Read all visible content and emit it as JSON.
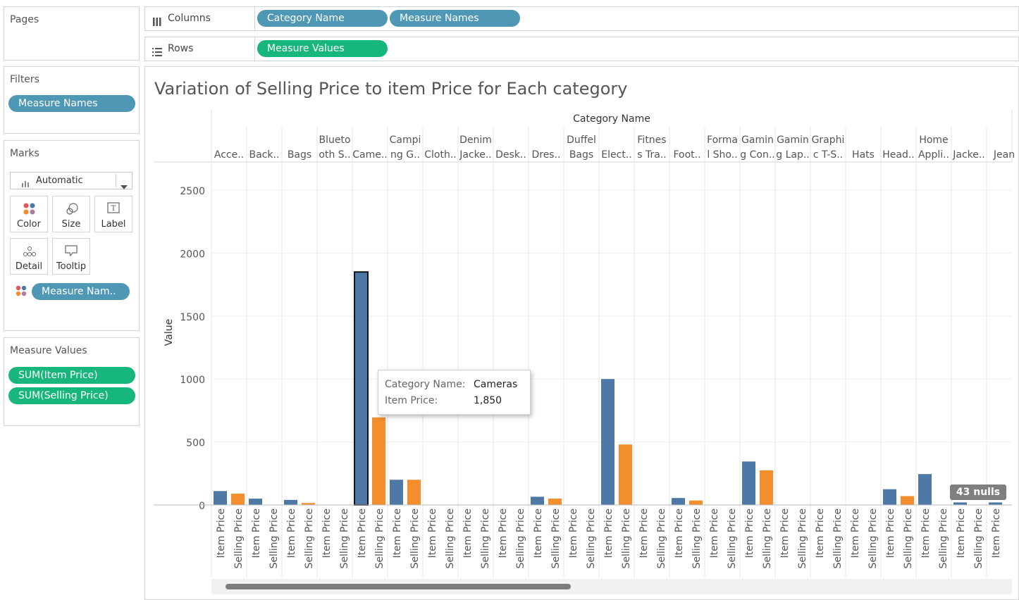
{
  "pages": {
    "title": "Pages"
  },
  "filters": {
    "title": "Filters",
    "pills": [
      "Measure Names"
    ]
  },
  "marks": {
    "title": "Marks",
    "mark_type": "Automatic",
    "buttons": [
      "Color",
      "Size",
      "Label",
      "Detail",
      "Tooltip"
    ],
    "color_pill": "Measure Nam.."
  },
  "measure_values": {
    "title": "Measure Values",
    "pills": [
      "SUM(Item Price)",
      "SUM(Selling Price)"
    ]
  },
  "shelves": {
    "columns_label": "Columns",
    "columns_pills": [
      "Category Name",
      "Measure Names"
    ],
    "rows_label": "Rows",
    "rows_pills": [
      "Measure Values"
    ]
  },
  "colors": {
    "pill_blue": "#4e97b5",
    "pill_green": "#17b67a",
    "series_item": "#4e79a7",
    "series_selling": "#f28e2b"
  },
  "tooltip": {
    "k1": "Category Name:",
    "v1": "Cameras",
    "k2": "Item Price:",
    "v2": "1,850"
  },
  "nulls_badge": "43 nulls",
  "chart_data": {
    "type": "bar",
    "title": "Variation of Selling Price to item Price for Each category",
    "column_header": "Category Name",
    "ylabel": "Value",
    "ylim": [
      0,
      2500
    ],
    "yticks": [
      0,
      500,
      1000,
      1500,
      2000,
      2500
    ],
    "grid": true,
    "measure_labels": [
      "Item Price",
      "Selling Price"
    ],
    "categories": [
      [
        "Acce.."
      ],
      [
        "Back.."
      ],
      [
        "Bags"
      ],
      [
        "Blueto",
        "oth S.."
      ],
      [
        "Came.."
      ],
      [
        "Campi",
        "ng G.."
      ],
      [
        "Cloth.."
      ],
      [
        "Denim",
        "Jacke.."
      ],
      [
        "Desk.."
      ],
      [
        "Dres.."
      ],
      [
        "Duffel",
        "Bags"
      ],
      [
        "Elect.."
      ],
      [
        "Fitnes",
        "s Tra.."
      ],
      [
        "Foot.."
      ],
      [
        "Forma",
        "l Sho.."
      ],
      [
        "Gamin",
        "g Con.."
      ],
      [
        "Gamin",
        "g Lap.."
      ],
      [
        "Graphi",
        "c T-S.."
      ],
      [
        "Hats"
      ],
      [
        "Head.."
      ],
      [
        "Home",
        "Appli.."
      ],
      [
        "Jacke.."
      ],
      [
        "Jean"
      ]
    ],
    "series": [
      {
        "name": "Item Price",
        "values": [
          110,
          50,
          40,
          null,
          1850,
          200,
          null,
          null,
          null,
          65,
          null,
          1000,
          null,
          55,
          null,
          345,
          null,
          null,
          null,
          125,
          245,
          20,
          20
        ]
      },
      {
        "name": "Selling Price",
        "values": [
          90,
          null,
          15,
          null,
          695,
          200,
          null,
          null,
          null,
          50,
          null,
          480,
          null,
          35,
          null,
          275,
          null,
          null,
          null,
          70,
          null,
          null,
          20
        ]
      }
    ]
  }
}
